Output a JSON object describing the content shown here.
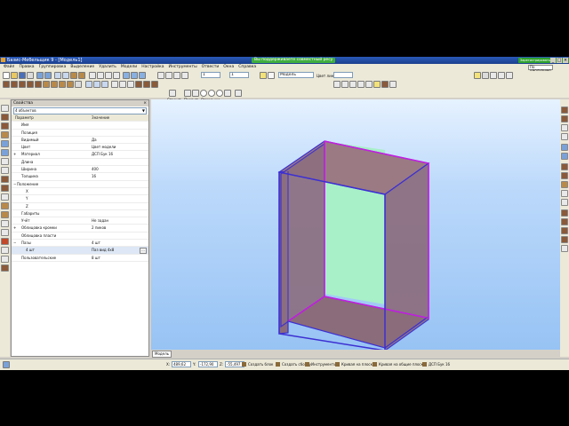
{
  "window": {
    "title": "Базис-Мебельщик 9 - [Модель1]",
    "notice": "Вы поддерживаете совместный ресу",
    "register": "Зарегистрировать лицензию"
  },
  "window_buttons": [
    "_",
    "□",
    "×"
  ],
  "menu": {
    "items": [
      "Файл",
      "Правка",
      "Группировка",
      "Выделение",
      "Удалить",
      "Модели",
      "Настройка",
      "Инструменты",
      "Отвести",
      "Окна",
      "Справка"
    ],
    "view_label": "По умолчанию"
  },
  "toolbar": {
    "step_value": "1",
    "zoom_value": "1",
    "angle_value": "10",
    "layer_value": "Модель",
    "color_label": "Цвет линии:",
    "mode_tabs": [
      "Строить",
      "Править",
      "Операции"
    ]
  },
  "properties_panel": {
    "title": "Свойства",
    "close_label": "×",
    "object_selector": "4 объектов",
    "columns": {
      "param": "Параметр",
      "value": "Значение"
    },
    "rows": [
      {
        "key": "Имя",
        "value": "",
        "indent": 1
      },
      {
        "key": "Позиция",
        "value": "",
        "indent": 1
      },
      {
        "key": "Видимый",
        "value": "Да",
        "indent": 1
      },
      {
        "key": "Цвет",
        "value": "Цвет модели",
        "indent": 1
      },
      {
        "key": "Материал",
        "value": "ДСП Бук 16",
        "indent": 1,
        "expand": "+"
      },
      {
        "key": "Длина",
        "value": "",
        "indent": 1
      },
      {
        "key": "Ширина",
        "value": "400",
        "indent": 1
      },
      {
        "key": "Толщина",
        "value": "16",
        "indent": 1
      },
      {
        "key": "Положение",
        "value": "",
        "indent": 0,
        "expand": "−"
      },
      {
        "key": "X",
        "value": "",
        "indent": 2
      },
      {
        "key": "Y",
        "value": "",
        "indent": 2
      },
      {
        "key": "Z",
        "value": "",
        "indent": 2
      },
      {
        "key": "Габариты",
        "value": "",
        "indent": 1
      },
      {
        "key": "Учёт",
        "value": "Не задан",
        "indent": 1
      },
      {
        "key": "Облицовка кромки",
        "value": "2 пиков",
        "indent": 1,
        "expand": "+"
      },
      {
        "key": "Облицовка пласти",
        "value": "",
        "indent": 1
      },
      {
        "key": "Пазы",
        "value": "4 шт",
        "indent": 1,
        "expand": "−"
      },
      {
        "key": "4 шт",
        "value": "Паз вид 4x8",
        "indent": 2,
        "active": true
      },
      {
        "key": "Пользовательские",
        "value": "8 шт",
        "indent": 1
      }
    ]
  },
  "viewport": {
    "tab_label": "Модель"
  },
  "status": {
    "x_label": "X:",
    "x_value": "489,62",
    "y_label": "Y:",
    "y_value": "-172,90",
    "z_label": "Z:",
    "z_value": "-55,497",
    "buttons": [
      "Создать блок",
      "Создать сборку",
      "Инструменты",
      "Кривая на плоск.",
      "Кривая на общие плоск.",
      "ДСП Бук 16"
    ]
  }
}
